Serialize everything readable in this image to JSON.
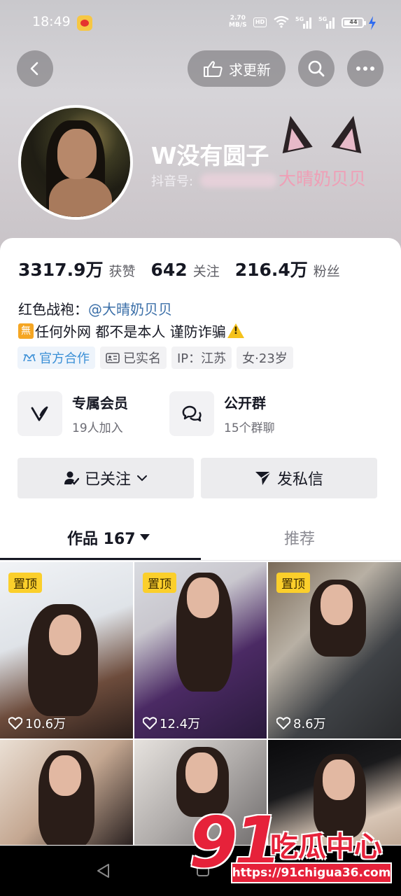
{
  "status_bar": {
    "time": "18:49",
    "net_speed_value": "2.70",
    "net_speed_unit": "MB/S",
    "hd_label": "HD",
    "signal_label_1": "5G",
    "signal_label_2": "5G",
    "battery_level": "44",
    "icons": [
      "weibo-icon",
      "wifi-icon",
      "signal-icon",
      "battery-icon",
      "charging-icon"
    ]
  },
  "top_nav": {
    "request_update_label": "求更新",
    "icons": [
      "back-arrow-icon",
      "hand-point-icon",
      "search-icon",
      "more-icon"
    ]
  },
  "profile": {
    "nickname": "W没有圆子",
    "douyin_id_label": "抖音号:",
    "douyin_id_overlay": "大晴奶贝贝"
  },
  "stats": [
    {
      "value": "3317.9万",
      "label": "获赞"
    },
    {
      "value": "642",
      "label": "关注"
    },
    {
      "value": "216.4万",
      "label": "粉丝"
    }
  ],
  "bio": {
    "line1_prefix": "红色战袍：",
    "line1_mention": "@大晴奶贝贝",
    "line2_badge": "無",
    "line2_text": "任何外网 都不是本人 谨防诈骗"
  },
  "tags": {
    "official": "官方合作",
    "verified": "已实名",
    "ip": "IP：江苏",
    "gender_age": "女·23岁"
  },
  "features": {
    "member_title": "专属会员",
    "member_sub": "19人加入",
    "group_title": "公开群",
    "group_sub": "15个群聊"
  },
  "actions": {
    "followed_label": "已关注",
    "message_label": "发私信"
  },
  "tabs": {
    "works_label": "作品 167",
    "recommend_label": "推荐"
  },
  "videos": [
    {
      "pinned": "置顶",
      "likes": "10.6万"
    },
    {
      "pinned": "置顶",
      "likes": "12.4万"
    },
    {
      "pinned": "置顶",
      "likes": "8.6万"
    }
  ],
  "watermark": {
    "number": "91",
    "text": "吃瓜中心",
    "url": "https://91chigua36.com"
  },
  "colors": {
    "accent_mention": "#3b6fa8",
    "pin_badge": "#fbcf2b",
    "watermark_red": "#e6223a"
  }
}
